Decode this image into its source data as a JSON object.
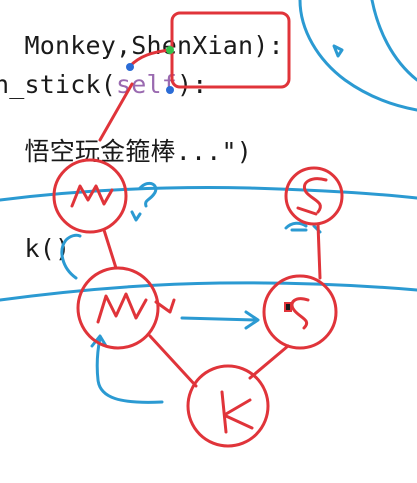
{
  "code": {
    "line1": "Monkey,ShenXian):",
    "line2_a": "n_stick(",
    "line2_self": "self",
    "line2_b": "):",
    "line3": "悟空玩金箍棒...\")",
    "line4": "k()"
  },
  "colors": {
    "ink_red": "#e0343a",
    "ink_blue": "#2b9ad2",
    "code_text": "#1a1a1a",
    "keyword": "#9a6ab0",
    "string": "#1f7a3a"
  },
  "annotations": {
    "node_m_top": "m",
    "node_s_top": "S",
    "node_m_mid": "m",
    "node_s_mid": "s",
    "node_k": "k"
  }
}
